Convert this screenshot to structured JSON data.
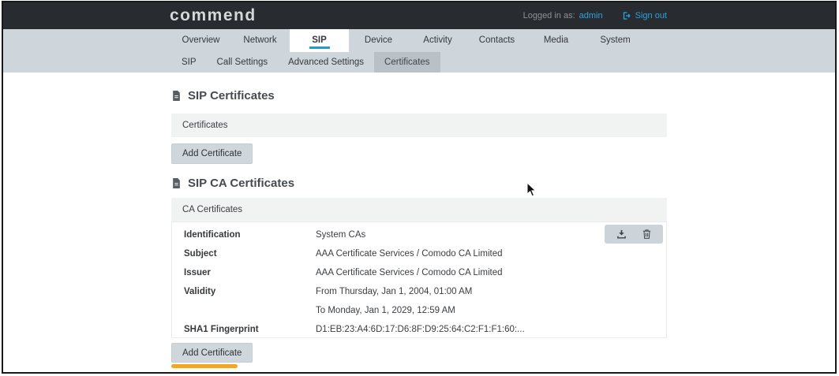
{
  "header": {
    "logo": "commend",
    "logged_in_label": "Logged in as:",
    "username": "admin",
    "sign_out_label": "Sign out"
  },
  "nav": {
    "tabs": [
      {
        "label": "Overview",
        "active": false
      },
      {
        "label": "Network",
        "active": false
      },
      {
        "label": "SIP",
        "active": true
      },
      {
        "label": "Device",
        "active": false
      },
      {
        "label": "Activity",
        "active": false
      },
      {
        "label": "Contacts",
        "active": false
      },
      {
        "label": "Media",
        "active": false
      },
      {
        "label": "System",
        "active": false
      }
    ],
    "subtabs": [
      {
        "label": "SIP",
        "active": false
      },
      {
        "label": "Call Settings",
        "active": false
      },
      {
        "label": "Advanced Settings",
        "active": false
      },
      {
        "label": "Certificates",
        "active": true
      }
    ]
  },
  "sip_certificates": {
    "title": "SIP Certificates",
    "list_header": "Certificates",
    "add_button_label": "Add Certificate"
  },
  "sip_ca_certificates": {
    "title": "SIP CA Certificates",
    "list_header": "CA Certificates",
    "add_button_label": "Add Certificate",
    "certificate": {
      "fields": [
        {
          "label": "Identification",
          "value": "System CAs"
        },
        {
          "label": "Subject",
          "value": "AAA Certificate Services / Comodo CA Limited"
        },
        {
          "label": "Issuer",
          "value": "AAA Certificate Services / Comodo CA Limited"
        },
        {
          "label": "Validity",
          "value": "From Thursday, Jan 1, 2004, 01:00 AM"
        },
        {
          "label": "",
          "value": "To Monday, Jan 1, 2029, 12:59 AM"
        },
        {
          "label": "SHA1 Fingerprint",
          "value": "D1:EB:23:A4:6D:17:D6:8F:D9:25:64:C2:F1:F1:60:..."
        }
      ],
      "actions": [
        "download",
        "delete"
      ]
    }
  },
  "colors": {
    "topbar": "#282b2f",
    "accent_blue": "#1e9cd6",
    "link_blue": "#2aa3dc",
    "nav_bg": "#ced5db",
    "subtab_active_bg": "#b9c0c6",
    "list_bar_bg": "#f1f2f2",
    "button_bg": "#cfd6dc",
    "highlight_orange": "#f1a81f"
  }
}
